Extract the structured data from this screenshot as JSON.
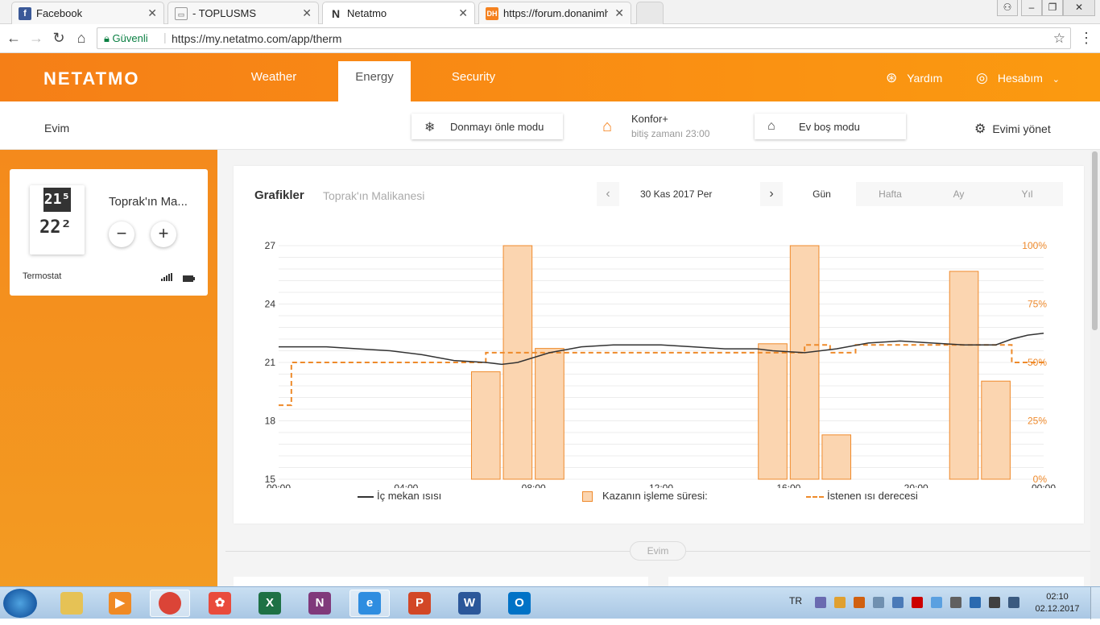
{
  "browser": {
    "tabs": [
      {
        "title": "Facebook",
        "favicon": "facebook-icon",
        "color": "#3b5998"
      },
      {
        "title": "- TOPLUSMS",
        "favicon": "page-icon",
        "color": "#888888"
      },
      {
        "title": "Netatmo",
        "favicon": "netatmo-icon",
        "color": "#333333"
      },
      {
        "title": "https://forum.donanimha",
        "favicon": "dh-icon",
        "color": "#f58220"
      }
    ],
    "secure_label": "Güvenli",
    "url": "https://my.netatmo.com/app/therm"
  },
  "header": {
    "brand": "NETATMO",
    "tabs": [
      {
        "label": "Weather"
      },
      {
        "label": "Energy"
      },
      {
        "label": "Security"
      }
    ],
    "help_label": "Yardım",
    "account_label": "Hesabım",
    "accent": "#f98b14"
  },
  "modebar": {
    "home": "Evim",
    "frost_mode": "Donmayı önle modu",
    "comfort_title": "Konfor+",
    "comfort_sub": "bitiş zamanı 23:00",
    "away_mode": "Ev boş modu",
    "manage": "Evimi yönet"
  },
  "device": {
    "setpoint": "21⁵",
    "current": "22²",
    "name": "Toprak'ın Ma...",
    "minus": "−",
    "plus": "+",
    "type": "Termostat"
  },
  "graph": {
    "title": "Grafikler",
    "subtitle": "Toprak'ın Malikanesi",
    "date": "30 Kas 2017 Per",
    "prev": "‹",
    "next": "›",
    "ranges": [
      "Gün",
      "Hafta",
      "Ay",
      "Yıl"
    ],
    "active_range": "Gün",
    "legend": {
      "indoor": "İç mekan ısısı",
      "boiler": "Kazanın işleme süresi:",
      "setpoint": "İstenen ısı derecesi"
    },
    "footer_label": "Evim"
  },
  "chart_data": {
    "type": "bar",
    "x_ticks": [
      "00:00",
      "04:00",
      "08:00",
      "12:00",
      "16:00",
      "20:00",
      "00:00"
    ],
    "y_left_ticks": [
      "15",
      "18",
      "21",
      "24",
      "27"
    ],
    "y_right_ticks": [
      "0%",
      "25%",
      "50%",
      "75%",
      "100%"
    ],
    "ylim_left": [
      15,
      27
    ],
    "ylim_right": [
      0,
      100
    ],
    "xlim_hours": [
      0,
      24
    ],
    "grid": true,
    "bar_width_hours": 0.9,
    "boiler_bars": [
      {
        "hour": 6.5,
        "percent": 46
      },
      {
        "hour": 7.5,
        "percent": 100
      },
      {
        "hour": 8.5,
        "percent": 56
      },
      {
        "hour": 15.5,
        "percent": 58
      },
      {
        "hour": 16.5,
        "percent": 100
      },
      {
        "hour": 17.5,
        "percent": 19
      },
      {
        "hour": 21.5,
        "percent": 89
      },
      {
        "hour": 22.5,
        "percent": 42
      }
    ],
    "indoor_temp": [
      [
        0,
        21.8
      ],
      [
        1.5,
        21.8
      ],
      [
        2.5,
        21.7
      ],
      [
        3.5,
        21.6
      ],
      [
        4.5,
        21.4
      ],
      [
        5.5,
        21.1
      ],
      [
        6.5,
        21.0
      ],
      [
        7,
        20.9
      ],
      [
        7.5,
        21.0
      ],
      [
        8.5,
        21.5
      ],
      [
        9.5,
        21.8
      ],
      [
        10.5,
        21.9
      ],
      [
        12,
        21.9
      ],
      [
        13,
        21.8
      ],
      [
        14,
        21.7
      ],
      [
        15,
        21.7
      ],
      [
        15.5,
        21.6
      ],
      [
        16.5,
        21.5
      ],
      [
        17.5,
        21.7
      ],
      [
        18.5,
        22.0
      ],
      [
        19.5,
        22.1
      ],
      [
        20.5,
        22.0
      ],
      [
        21.5,
        21.9
      ],
      [
        22.5,
        21.9
      ],
      [
        23,
        22.2
      ],
      [
        23.5,
        22.4
      ],
      [
        24,
        22.5
      ]
    ],
    "setpoint_steps": [
      [
        0,
        18.8
      ],
      [
        0.4,
        18.8
      ],
      [
        0.4,
        21.0
      ],
      [
        6.5,
        21.0
      ],
      [
        6.5,
        21.5
      ],
      [
        16.5,
        21.5
      ],
      [
        16.5,
        21.9
      ],
      [
        17.3,
        21.9
      ],
      [
        17.3,
        21.5
      ],
      [
        18.1,
        21.5
      ],
      [
        18.1,
        21.9
      ],
      [
        23.0,
        21.9
      ],
      [
        23.0,
        21.0
      ],
      [
        24,
        21.0
      ]
    ],
    "colors": {
      "indoor": "#333333",
      "boiler_fill": "#fbd5b0",
      "boiler_stroke": "#ef8a2c",
      "setpoint": "#ee8a2a",
      "right_axis": "#ef8a2c"
    }
  },
  "taskbar": {
    "lang": "TR",
    "time": "02:10",
    "date": "02.12.2017",
    "apps": [
      {
        "name": "explorer-icon",
        "label": "",
        "color": "#e6c255"
      },
      {
        "name": "media-player-icon",
        "label": "▶",
        "color": "#f08a24"
      },
      {
        "name": "chrome-icon",
        "label": "",
        "color": "#db4437"
      },
      {
        "name": "dh-app-icon",
        "label": "✿",
        "color": "#e94b3c"
      },
      {
        "name": "excel-icon",
        "label": "X",
        "color": "#1e7145"
      },
      {
        "name": "onenote-icon",
        "label": "N",
        "color": "#80397b"
      },
      {
        "name": "ie-icon",
        "label": "e",
        "color": "#2e8de0"
      },
      {
        "name": "powerpoint-icon",
        "label": "P",
        "color": "#d24726"
      },
      {
        "name": "word-icon",
        "label": "W",
        "color": "#2b579a"
      },
      {
        "name": "outlook-icon",
        "label": "O",
        "color": "#0072c6"
      }
    ]
  }
}
